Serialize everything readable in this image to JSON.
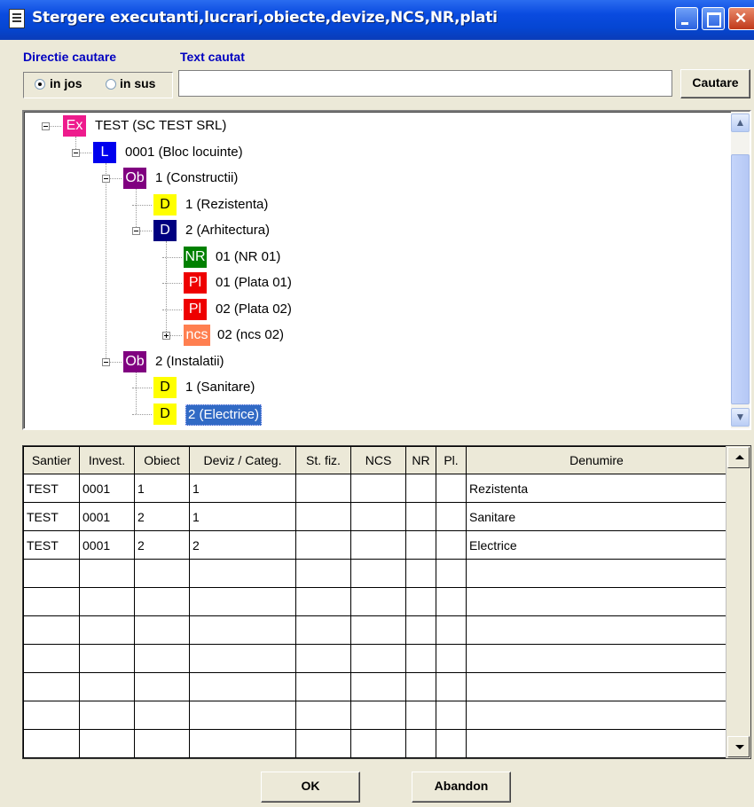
{
  "window": {
    "title": "Stergere executanti,lucrari,obiecte,devize,NCS,NR,plati"
  },
  "search": {
    "direction_label": "Directie cautare",
    "text_label": "Text cautat",
    "opt_down": "in jos",
    "opt_up": "in sus",
    "selected": "in jos",
    "value": "",
    "button": "Cautare"
  },
  "tree": {
    "nodes": [
      {
        "badge": "Ex",
        "badge_color": "#ee1b8d",
        "label": "TEST (SC TEST SRL)",
        "level": 0,
        "expander": "minus"
      },
      {
        "badge": "L",
        "badge_color": "#0000ee",
        "label": "0001 (Bloc locuinte)",
        "level": 1,
        "expander": "minus"
      },
      {
        "badge": "Ob",
        "badge_color": "#800080",
        "label": "1 (Constructii)",
        "level": 2,
        "expander": "minus"
      },
      {
        "badge": "D",
        "badge_color": "#ffff00",
        "label": "1 (Rezistenta)",
        "level": 3,
        "expander": "none"
      },
      {
        "badge": "D",
        "badge_color": "#000080",
        "label": "2 (Arhitectura)",
        "level": 3,
        "expander": "minus"
      },
      {
        "badge": "NR",
        "badge_color": "#008000",
        "label": "01 (NR 01)",
        "level": 4,
        "expander": "none"
      },
      {
        "badge": "Pl",
        "badge_color": "#ee0000",
        "label": "01 (Plata 01)",
        "level": 4,
        "expander": "none"
      },
      {
        "badge": "Pl",
        "badge_color": "#ee0000",
        "label": "02 (Plata 02)",
        "level": 4,
        "expander": "none"
      },
      {
        "badge": "ncs",
        "badge_color": "#ff7f50",
        "label": "02 (ncs 02)",
        "level": 4,
        "expander": "plus"
      },
      {
        "badge": "Ob",
        "badge_color": "#800080",
        "label": "2 (Instalatii)",
        "level": 2,
        "expander": "minus"
      },
      {
        "badge": "D",
        "badge_color": "#ffff00",
        "label": "1 (Sanitare)",
        "level": 3,
        "expander": "none"
      },
      {
        "badge": "D",
        "badge_color": "#ffff00",
        "label": "2 (Electrice)",
        "level": 3,
        "expander": "none",
        "selected": true
      }
    ]
  },
  "grid": {
    "columns": [
      "Santier",
      "Invest.",
      "Obiect",
      "Deviz / Categ.",
      "St. fiz.",
      "NCS",
      "NR",
      "Pl.",
      "Denumire"
    ],
    "rows": [
      [
        "TEST",
        "0001",
        "1",
        "1",
        "",
        "",
        "",
        "",
        "Rezistenta"
      ],
      [
        "TEST",
        "0001",
        "2",
        "1",
        "",
        "",
        "",
        "",
        "Sanitare"
      ],
      [
        "TEST",
        "0001",
        "2",
        "2",
        "",
        "",
        "",
        "",
        "Electrice"
      ],
      [
        "",
        "",
        "",
        "",
        "",
        "",
        "",
        "",
        ""
      ],
      [
        "",
        "",
        "",
        "",
        "",
        "",
        "",
        "",
        ""
      ],
      [
        "",
        "",
        "",
        "",
        "",
        "",
        "",
        "",
        ""
      ],
      [
        "",
        "",
        "",
        "",
        "",
        "",
        "",
        "",
        ""
      ],
      [
        "",
        "",
        "",
        "",
        "",
        "",
        "",
        "",
        ""
      ],
      [
        "",
        "",
        "",
        "",
        "",
        "",
        "",
        "",
        ""
      ],
      [
        "",
        "",
        "",
        "",
        "",
        "",
        "",
        "",
        ""
      ]
    ]
  },
  "buttons": {
    "ok": "OK",
    "cancel": "Abandon"
  }
}
